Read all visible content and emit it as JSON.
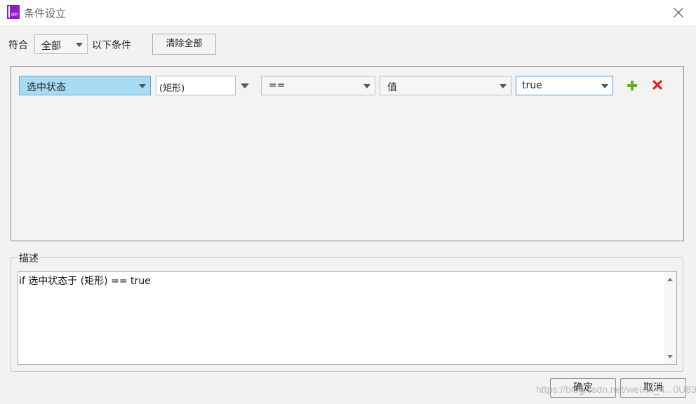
{
  "window": {
    "title": "条件设立",
    "logo_text": "RP",
    "logo_color": "#8e1fc6",
    "close_icon": "close-icon"
  },
  "top_bar": {
    "match_label": "符合",
    "match_select_value": "全部",
    "conditions_label": "以下条件",
    "clear_all_label": "清除全部"
  },
  "condition_row": {
    "field_value": "选中状态",
    "target_value": "(矩形)",
    "operator_value": "==",
    "value_type": "值",
    "value": "true",
    "add_icon": "plus-icon",
    "remove_icon": "delete-icon",
    "add_color": "#6aa82e",
    "remove_color": "#e02020",
    "selected_color": "#a8dcf2"
  },
  "description": {
    "legend": "描述",
    "text": "if 选中状态于 (矩形) == true"
  },
  "footer": {
    "ok_label": "确定",
    "cancel_label": "取消"
  },
  "watermark": "https://blog.csdn.net/weixin_4...0U83"
}
